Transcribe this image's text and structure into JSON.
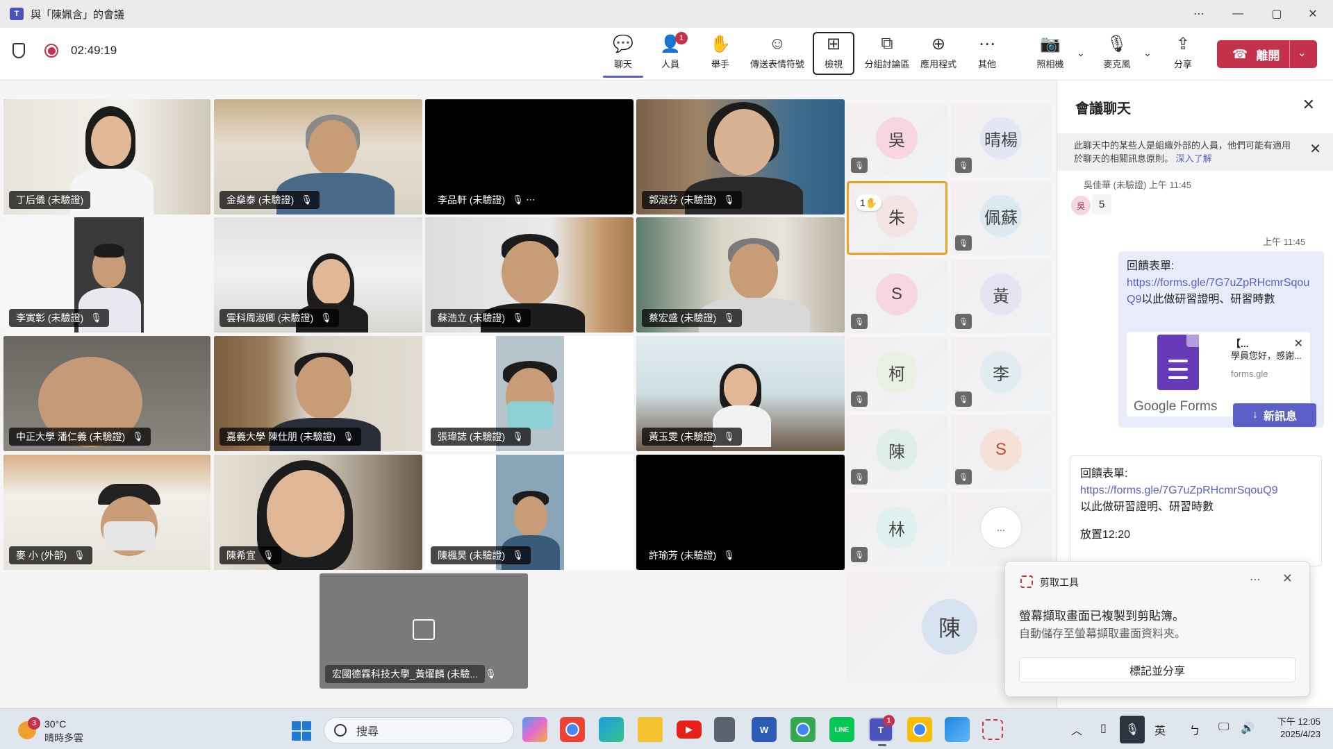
{
  "window": {
    "title": "與「陳姵含」的會議",
    "controls": [
      "⋯",
      "—",
      "▢",
      "✕"
    ]
  },
  "toolbar": {
    "timer": "02:49:19",
    "buttons": [
      {
        "label": "聊天",
        "icon": "chat-icon"
      },
      {
        "label": "人員",
        "icon": "people-icon",
        "badge": "1"
      },
      {
        "label": "舉手",
        "icon": "raise-hand-icon"
      },
      {
        "label": "傳送表情符號",
        "icon": "emoji-icon"
      },
      {
        "label": "檢視",
        "icon": "grid-view-icon"
      },
      {
        "label": "分組討論區",
        "icon": "breakout-rooms-icon"
      },
      {
        "label": "應用程式",
        "icon": "apps-add-icon"
      },
      {
        "label": "其他",
        "icon": "more-icon"
      },
      {
        "label": "照相機",
        "icon": "camera-off-icon"
      },
      {
        "label": "麥克風",
        "icon": "microphone-icon"
      },
      {
        "label": "分享",
        "icon": "share-icon"
      }
    ],
    "leave_label": "離開"
  },
  "video_tiles": [
    {
      "name": "丁后儀 (未驗證)",
      "mic": ""
    },
    {
      "name": "金燊泰 (未驗證)",
      "mic": "🎙"
    },
    {
      "name": "李品軒 (未驗證)",
      "mic": "🎙  ⋯"
    },
    {
      "name": "郭淑芬 (未驗證)",
      "mic": "🎙"
    },
    {
      "name": "李寅彰 (未驗證)",
      "mic": "🎙"
    },
    {
      "name": "雲科周淑卿 (未驗證)",
      "mic": "🎙"
    },
    {
      "name": "蘇浩立 (未驗證)",
      "mic": "🎙"
    },
    {
      "name": "蔡宏盛 (未驗證)",
      "mic": "🎙"
    },
    {
      "name": "中正大學 潘仁義 (未驗證)",
      "mic": "🎙"
    },
    {
      "name": "嘉義大學 陳仕朋 (未驗證)",
      "mic": "🎙"
    },
    {
      "name": "張瑋誌 (未驗證)",
      "mic": "🎙"
    },
    {
      "name": "黃玉雯 (未驗證)",
      "mic": "🎙"
    },
    {
      "name": "麥 小 (外部)",
      "mic": "🎙"
    },
    {
      "name": "陳希宜",
      "mic": "🎙"
    },
    {
      "name": "陳楓昊 (未驗證)",
      "mic": "🎙"
    },
    {
      "name": "許瑜芳 (未驗證)",
      "mic": "🎙"
    },
    {
      "name": "宏國德霖科技大學_黃燿麟 (未驗...",
      "mic": "🎙"
    }
  ],
  "avatars": [
    {
      "initials": "吳",
      "color": "#f7d6e0"
    },
    {
      "initials": "晴楊",
      "color": "#e2e6f3"
    },
    {
      "initials": "朱",
      "color": "#f3e3e3",
      "raised_hand": "1✋"
    },
    {
      "initials": "佩蘇",
      "color": "#dce9f1"
    },
    {
      "initials": "S",
      "color": "#f7d6e0"
    },
    {
      "initials": "黃",
      "color": "#e7e2f2"
    },
    {
      "initials": "柯",
      "color": "#e9f0e2"
    },
    {
      "initials": "李",
      "color": "#e0ecef"
    },
    {
      "initials": "陳",
      "color": "#dfeee8"
    },
    {
      "initials": "S",
      "color": "#f5e0d8"
    },
    {
      "initials": "林",
      "color": "#dff0ee"
    },
    {
      "initials": "...",
      "color": "#ffffff"
    },
    {
      "initials": "陳",
      "color": "#d7e3f0"
    }
  ],
  "chat": {
    "title": "會議聊天",
    "notice": "此聊天中的某些人是組織外部的人員，他們可能有適用於聊天的相關訊息原則。",
    "notice_link": "深入了解",
    "msg1_meta": "吳佳華 (未驗證)  上午 11:45",
    "msg1_avatar": "吳",
    "msg1_text": "5",
    "msg2_time": "上午 11:45",
    "msg2_prefix": "回饋表單:",
    "msg2_link": "https://forms.gle/7G7uZpRHcmrSqouQ9",
    "msg2_suffix": "以此做研習證明、研習時數",
    "card_brand": "Google Forms",
    "card_title": "【...",
    "card_desc": "學員您好，感謝...",
    "card_domain": "forms.gle",
    "new_message_btn": "新訊息",
    "pinned_prefix": "回饋表單:",
    "pinned_link": "https://forms.gle/7G7uZpRHcmrSqouQ9",
    "pinned_suffix": "以此做研習證明、研習時數",
    "pinned_note": "放置12:20"
  },
  "toast": {
    "app": "剪取工具",
    "line1": "螢幕擷取畫面已複製到剪貼簿。",
    "line2": "自動儲存至螢幕擷取畫面資料夾。",
    "button": "標記並分享"
  },
  "taskbar": {
    "weather_temp": "30°C",
    "weather_desc": "晴時多雲",
    "weather_badge": "3",
    "search_placeholder": "搜尋",
    "apps": [
      {
        "name": "copilot-icon",
        "color": "#b06cf0",
        "label": ""
      },
      {
        "name": "chrome-icon",
        "color": "#4285f4",
        "label": ""
      },
      {
        "name": "edge-icon",
        "color": "#1b9de2",
        "label": ""
      },
      {
        "name": "file-explorer-icon",
        "color": "#f2c230",
        "label": ""
      },
      {
        "name": "youtube-icon",
        "color": "#e62117",
        "label": "▶"
      },
      {
        "name": "calculator-icon",
        "color": "#5a6470",
        "label": ""
      },
      {
        "name": "word-icon",
        "color": "#2b5cb8",
        "label": "W"
      },
      {
        "name": "chrome-profile-icon",
        "color": "#4285f4",
        "label": ""
      },
      {
        "name": "line-icon",
        "color": "#06c755",
        "label": "LINE"
      },
      {
        "name": "teams-icon",
        "color": "#4b53bc",
        "label": "T",
        "badge": "1"
      },
      {
        "name": "chrome-profile2-icon",
        "color": "#4285f4",
        "label": ""
      },
      {
        "name": "photos-icon",
        "color": "#1e88e5",
        "label": ""
      },
      {
        "name": "snipping-tool-icon",
        "color": "#ffffff",
        "label": ""
      }
    ],
    "tray": [
      "︿",
      "▯",
      "🎙",
      "英",
      "ㄅ",
      "🖵",
      "🔊"
    ],
    "time": "下午 12:05",
    "date": "2025/4/23"
  }
}
